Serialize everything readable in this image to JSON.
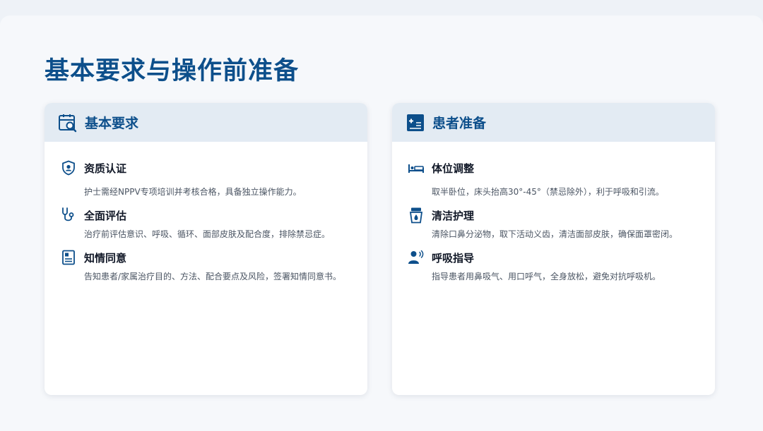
{
  "page": {
    "title": "基本要求与操作前准备"
  },
  "colors": {
    "brand": "#0d4f8b",
    "header_bg": "#e3ebf3",
    "page_bg": "#f6f8fb"
  },
  "left_card": {
    "title": "基本要求",
    "icon": "calendar-search-icon",
    "items": [
      {
        "title": "资质认证",
        "icon": "shield-user-icon",
        "desc": "护士需经NPPV专项培训并考核合格，具备独立操作能力。"
      },
      {
        "title": "全面评估",
        "icon": "stethoscope-icon",
        "desc": "治疗前评估意识、呼吸、循环、面部皮肤及配合度，排除禁忌症。"
      },
      {
        "title": "知情同意",
        "icon": "document-icon",
        "desc": "告知患者/家属治疗目的、方法、配合要点及风险，签署知情同意书。"
      }
    ]
  },
  "right_card": {
    "title": "患者准备",
    "icon": "medical-plus-icon",
    "items": [
      {
        "title": "体位调整",
        "icon": "bed-icon",
        "desc": "取半卧位，床头抬高30°-45°（禁忌除外），利于呼吸和引流。"
      },
      {
        "title": "清洁护理",
        "icon": "cleanser-icon",
        "desc": "清除口鼻分泌物，取下活动义齿，清洁面部皮肤，确保面罩密闭。"
      },
      {
        "title": "呼吸指导",
        "icon": "user-voice-icon",
        "desc": "指导患者用鼻吸气、用口呼气，全身放松，避免对抗呼吸机。"
      }
    ]
  }
}
